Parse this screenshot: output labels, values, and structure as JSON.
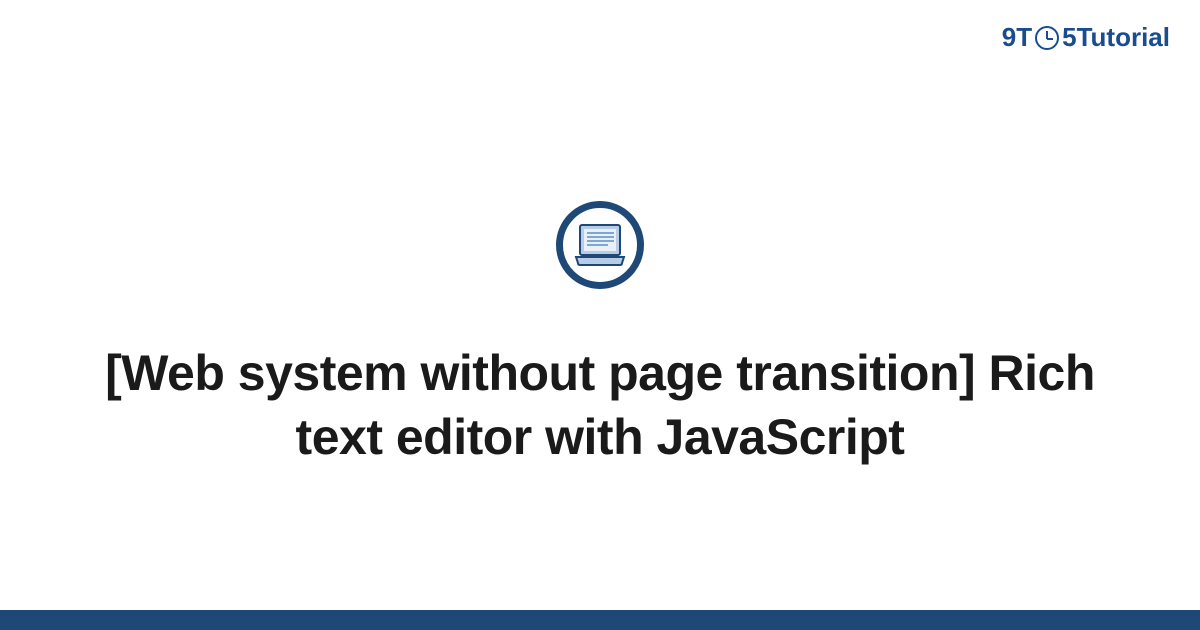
{
  "logo": {
    "part1": "9T",
    "part2": "5",
    "part3": "Tutorial"
  },
  "icon": {
    "name": "laptop-icon"
  },
  "title": "[Web system without page transition] Rich text editor with JavaScript",
  "colors": {
    "brand_dark": "#1e4976",
    "brand_logo": "#1a4d8f",
    "icon_fill": "#b8cce8"
  }
}
